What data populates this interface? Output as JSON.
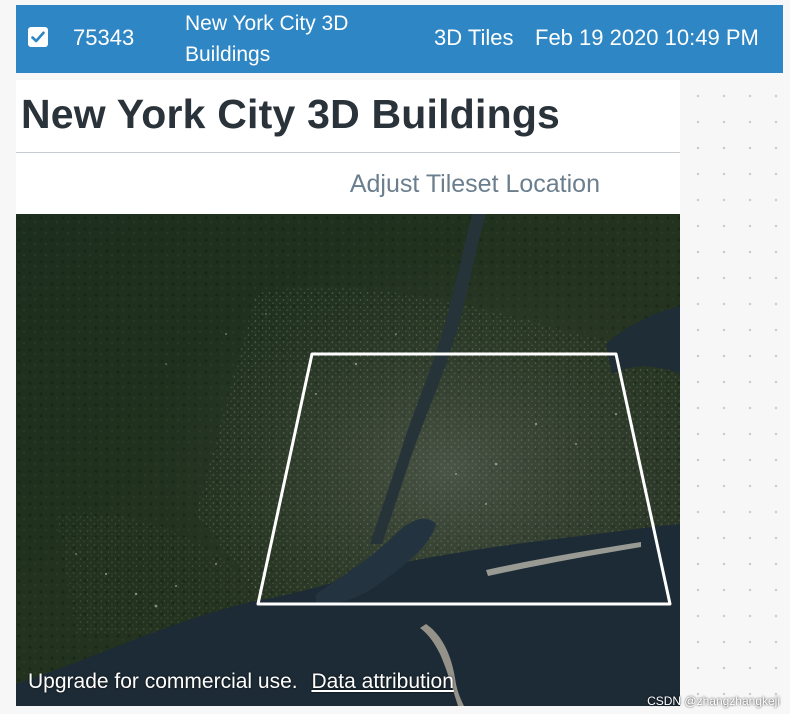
{
  "asset_row": {
    "selected": true,
    "id": "75343",
    "name": "New York City 3D Buildings",
    "type": "3D Tiles",
    "date_added": "Feb 19 2020 10:49 PM",
    "highlight_color": "#2f86c4"
  },
  "details": {
    "title": "New York City 3D Buildings",
    "adjust_location_label": "Adjust Tileset Location"
  },
  "map_viewer": {
    "credit_text": "Upgrade for commercial use.",
    "attribution_link": "Data attribution",
    "tileset_outline_color": "#ffffff"
  },
  "watermark": "CSDN @zhangzhangkeji",
  "icons": {
    "checkbox": "checkmark-icon"
  }
}
